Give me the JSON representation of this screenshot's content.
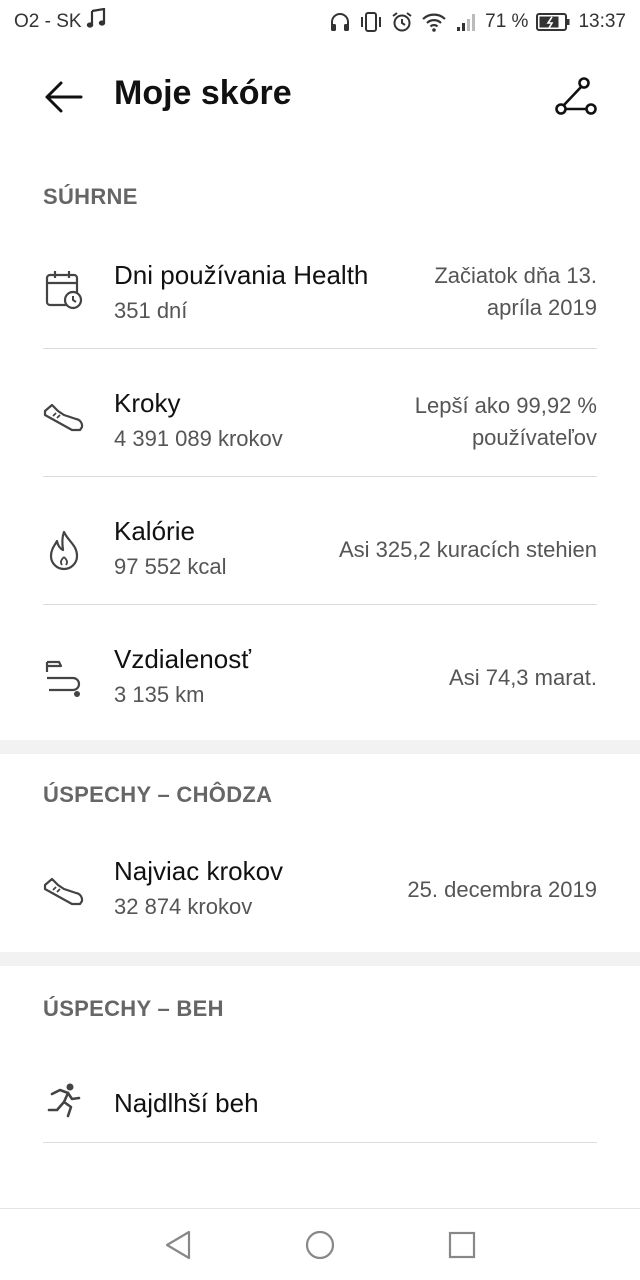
{
  "status_bar": {
    "carrier": "O2 - SK",
    "battery_percent": "71 %",
    "time": "13:37"
  },
  "header": {
    "title": "Moje skóre"
  },
  "sections": {
    "summary": {
      "header": "SÚHRNE",
      "items": [
        {
          "title": "Dni používania Health",
          "sub": "351 dní",
          "right_line1": "Začiatok dňa 13.",
          "right_line2": "apríla 2019",
          "icon": "calendar-clock-icon"
        },
        {
          "title": "Kroky",
          "sub": "4 391 089 krokov",
          "right_line1": "Lepší ako 99,92 %",
          "right_line2": "používateľov",
          "icon": "shoe-icon"
        },
        {
          "title": "Kalórie",
          "sub": "97 552 kcal",
          "right_line1": "Asi 325,2 kuracích stehien",
          "icon": "flame-icon"
        },
        {
          "title": "Vzdialenosť",
          "sub": "3 135 km",
          "right_line1": "Asi 74,3 marat.",
          "icon": "route-flag-icon"
        }
      ]
    },
    "walking": {
      "header": "ÚSPECHY – CHÔDZA",
      "items": [
        {
          "title": "Najviac krokov",
          "sub": "32 874 krokov",
          "right_line1": "25. decembra 2019",
          "icon": "shoe-icon"
        }
      ]
    },
    "running": {
      "header": "ÚSPECHY – BEH",
      "items": [
        {
          "title": "Najdlhší beh",
          "icon": "runner-icon"
        }
      ]
    }
  }
}
